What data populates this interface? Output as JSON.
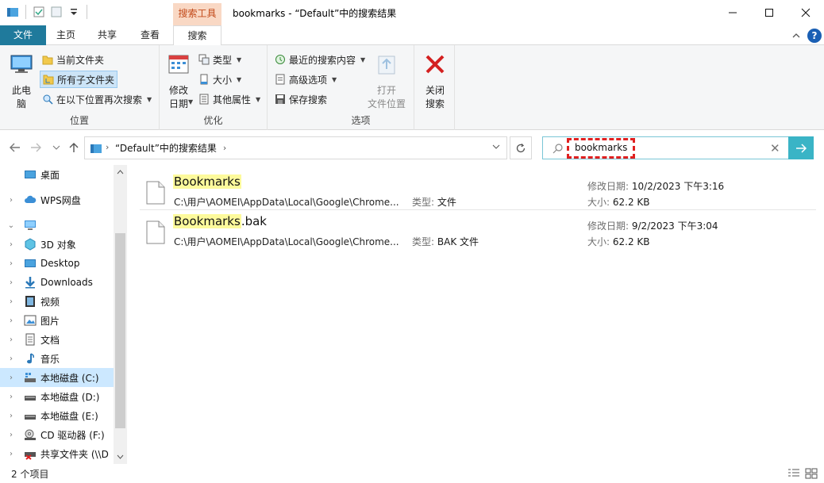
{
  "window": {
    "title": "bookmarks - “Default”中的搜索结果",
    "context_tab_header": "搜索工具"
  },
  "tabs": {
    "file": "文件",
    "home": "主页",
    "share": "共享",
    "view": "查看",
    "search": "搜索"
  },
  "ribbon": {
    "location": {
      "label": "位置",
      "this_pc": "此电\n脑",
      "current_folder": "当前文件夹",
      "all_subfolders": "所有子文件夹",
      "search_again": "在以下位置再次搜索"
    },
    "refine": {
      "label": "优化",
      "date_modified": "修改\n日期",
      "kind": "类型",
      "size": "大小",
      "other_props": "其他属性"
    },
    "options": {
      "label": "选项",
      "recent_searches": "最近的搜索内容",
      "advanced_options": "高级选项",
      "save_search": "保存搜索",
      "open_location": "打开\n文件位置",
      "close_search": "关闭\n搜索"
    }
  },
  "address": {
    "path_text": "“Default”中的搜索结果"
  },
  "search": {
    "value": "bookmarks"
  },
  "nav": {
    "items": [
      {
        "label": "桌面"
      },
      {
        "label": "WPS网盘"
      },
      {
        "label": ""
      },
      {
        "label": "3D 对象"
      },
      {
        "label": "Desktop"
      },
      {
        "label": "Downloads"
      },
      {
        "label": "视频"
      },
      {
        "label": "图片"
      },
      {
        "label": "文档"
      },
      {
        "label": "音乐"
      },
      {
        "label": "本地磁盘 (C:)"
      },
      {
        "label": "本地磁盘 (D:)"
      },
      {
        "label": "本地磁盘 (E:)"
      },
      {
        "label": "CD 驱动器 (F:)"
      },
      {
        "label": "共享文件夹 (\\\\D"
      }
    ]
  },
  "results": [
    {
      "name_match": "Bookmarks",
      "name_rest": "",
      "path": "C:\\用户\\AOMEI\\AppData\\Local\\Google\\Chrome...",
      "type_label": "类型:",
      "type_value": "文件",
      "date_label": "修改日期:",
      "date_value": "10/2/2023 下午3:16",
      "size_label": "大小:",
      "size_value": "62.2 KB"
    },
    {
      "name_match": "Bookmarks",
      "name_rest": ".bak",
      "path": "C:\\用户\\AOMEI\\AppData\\Local\\Google\\Chrome...",
      "type_label": "类型:",
      "type_value": "BAK 文件",
      "date_label": "修改日期:",
      "date_value": "9/2/2023 下午3:04",
      "size_label": "大小:",
      "size_value": "62.2 KB"
    }
  ],
  "status": {
    "count": "2 个项目"
  },
  "colors": {
    "file_tab": "#1f7a9c",
    "context_tab": "#f9d8c4",
    "search_go": "#3ab4c6",
    "highlight": "#fdfa9c",
    "callout": "#e02020"
  }
}
